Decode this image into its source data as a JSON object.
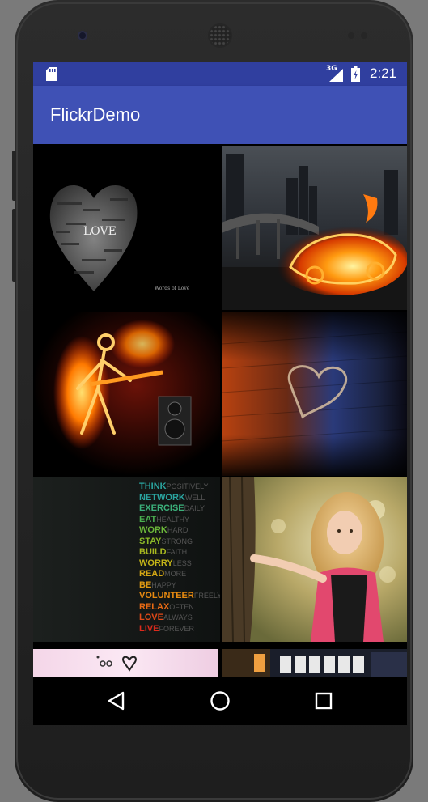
{
  "device": {
    "type": "phone",
    "status_bar": {
      "network_type": "3G",
      "time": "2:21",
      "icons": [
        "sd-card-icon",
        "signal-icon",
        "battery-icon"
      ]
    }
  },
  "app": {
    "title": "FlickrDemo"
  },
  "gallery": {
    "images": [
      {
        "name": "love-heart-words",
        "text": "LOVE",
        "caption": "Words of Love"
      },
      {
        "name": "flaming-car-city"
      },
      {
        "name": "fire-skeleton-guitar"
      },
      {
        "name": "heart-on-wood"
      },
      {
        "name": "motivation-words",
        "words": [
          [
            "THINK",
            "POSITIVELY"
          ],
          [
            "NETWORK",
            "WELL"
          ],
          [
            "EXERCISE",
            "DAILY"
          ],
          [
            "EAT",
            "HEALTHY"
          ],
          [
            "WORK",
            "HARD"
          ],
          [
            "STAY",
            "STRONG"
          ],
          [
            "BUILD",
            "FAITH"
          ],
          [
            "WORRY",
            "LESS"
          ],
          [
            "READ",
            "MORE"
          ],
          [
            "BE",
            "HAPPY"
          ],
          [
            "VOLUNTEER",
            "FREELY"
          ],
          [
            "RELAX",
            "OFTEN"
          ],
          [
            "LOVE",
            "ALWAYS"
          ],
          [
            "LIVE",
            "FOREVER"
          ]
        ]
      },
      {
        "name": "girl-by-tree"
      },
      {
        "name": "pink-hearts-partial"
      },
      {
        "name": "film-strip-partial"
      }
    ]
  },
  "navigation": {
    "buttons": [
      "back-icon",
      "home-icon",
      "recents-icon"
    ]
  },
  "colors": {
    "status_bar": "#303f9f",
    "app_bar": "#3f51b5",
    "screen_bg": "#000000"
  }
}
